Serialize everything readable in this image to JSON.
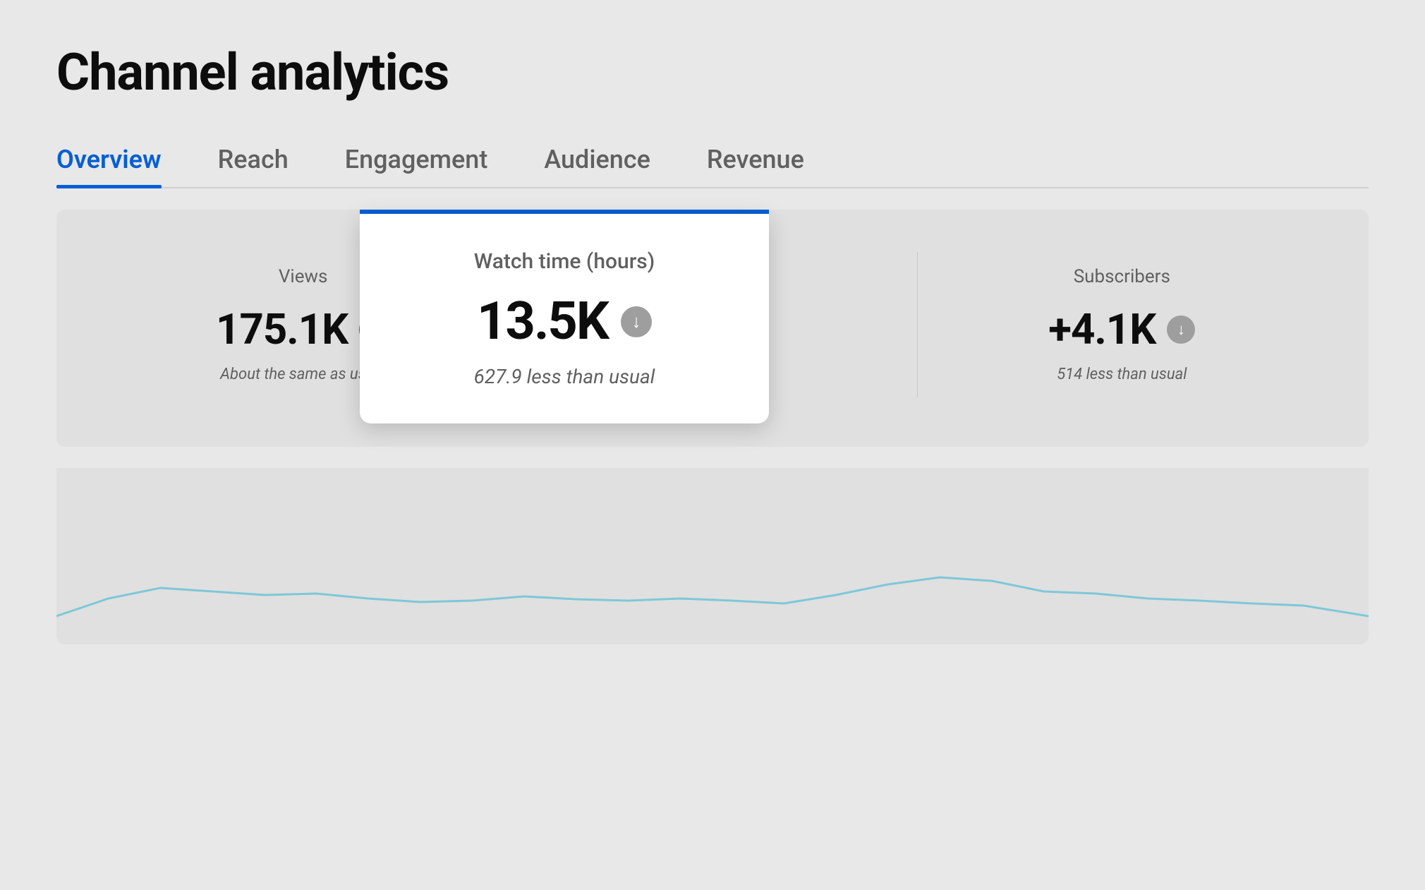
{
  "page": {
    "title": "Channel analytics"
  },
  "tabs": [
    {
      "id": "overview",
      "label": "Overview",
      "active": true
    },
    {
      "id": "reach",
      "label": "Reach",
      "active": false
    },
    {
      "id": "engagement",
      "label": "Engagement",
      "active": false
    },
    {
      "id": "audience",
      "label": "Audience",
      "active": false
    },
    {
      "id": "revenue",
      "label": "Revenue",
      "active": false
    }
  ],
  "stats": {
    "views": {
      "label": "Views",
      "value": "175.1K",
      "note": "About the same as usual",
      "trend": "neutral"
    },
    "watch_time": {
      "label": "Watch time (hours)",
      "value": "13.5K",
      "note": "627.9 less than usual",
      "trend": "down"
    },
    "subscribers": {
      "label": "Subscribers",
      "value": "+4.1K",
      "note": "514 less than usual",
      "trend": "down"
    }
  }
}
